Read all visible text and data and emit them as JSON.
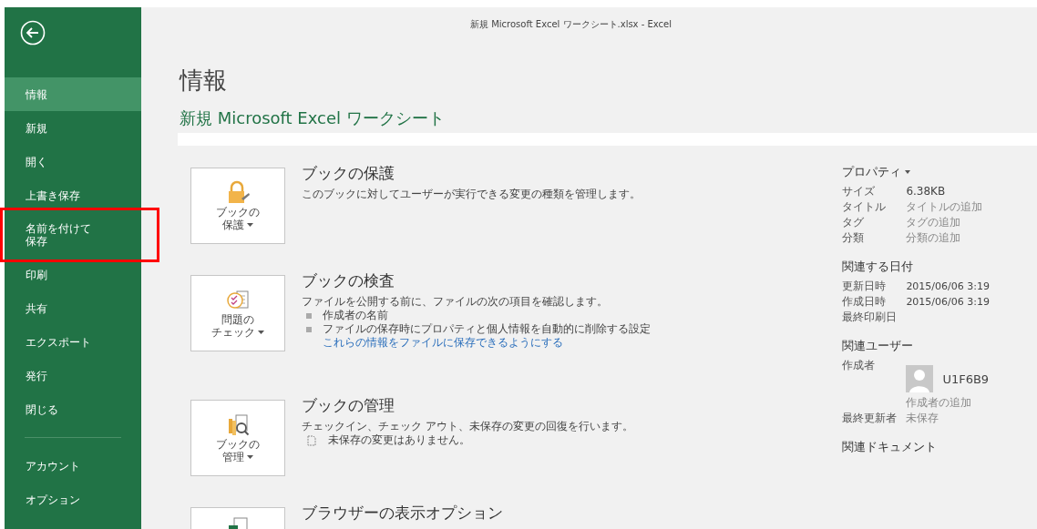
{
  "window": {
    "title": "新規 Microsoft Excel ワークシート.xlsx - Excel"
  },
  "sidebar": {
    "items": [
      {
        "label": "情報",
        "selected": true,
        "highlighted": false
      },
      {
        "label": "新規",
        "selected": false,
        "highlighted": false
      },
      {
        "label": "開く",
        "selected": false,
        "highlighted": false
      },
      {
        "label": "上書き保存",
        "selected": false,
        "highlighted": false
      },
      {
        "label": "名前を付けて保存",
        "selected": false,
        "highlighted": true
      },
      {
        "label": "印刷",
        "selected": false,
        "highlighted": false
      },
      {
        "label": "共有",
        "selected": false,
        "highlighted": false
      },
      {
        "label": "エクスポート",
        "selected": false,
        "highlighted": false
      },
      {
        "label": "発行",
        "selected": false,
        "highlighted": false
      },
      {
        "label": "閉じる",
        "selected": false,
        "highlighted": false
      }
    ],
    "bottom_items": [
      {
        "label": "アカウント",
        "selected": false,
        "highlighted": false
      },
      {
        "label": "オプション",
        "selected": false,
        "highlighted": false
      }
    ]
  },
  "page": {
    "heading": "情報",
    "document_name": "新規 Microsoft Excel ワークシート"
  },
  "sections": [
    {
      "kind": "protect",
      "button": [
        "ブックの",
        "保護"
      ],
      "title": "ブックの保護",
      "lines": [
        {
          "kind": "text",
          "text": "このブックに対してユーザーが実行できる変更の種類を管理します。"
        }
      ]
    },
    {
      "kind": "inspect",
      "button": [
        "問題の",
        "チェック"
      ],
      "title": "ブックの検査",
      "lines": [
        {
          "kind": "text",
          "text": "ファイルを公開する前に、ファイルの次の項目を確認します。"
        },
        {
          "kind": "bullet",
          "text": "作成者の名前"
        },
        {
          "kind": "bullet",
          "text": "ファイルの保存時にプロパティと個人情報を自動的に削除する設定"
        },
        {
          "kind": "link",
          "text": "これらの情報をファイルに保存できるようにする"
        }
      ]
    },
    {
      "kind": "manage",
      "button": [
        "ブックの",
        "管理"
      ],
      "title": "ブックの管理",
      "lines": [
        {
          "kind": "text",
          "text": "チェックイン、チェック アウト、未保存の変更の回復を行います。"
        },
        {
          "kind": "note",
          "text": "未保存の変更はありません。"
        }
      ]
    },
    {
      "kind": "browser",
      "title": "ブラウザーの表示オプション"
    }
  ],
  "properties": {
    "title": "プロパティ",
    "rows": [
      {
        "label": "サイズ",
        "value": "6.38KB",
        "kind": "value"
      },
      {
        "label": "タイトル",
        "value": "タイトルの追加",
        "kind": "hint"
      },
      {
        "label": "タグ",
        "value": "タグの追加",
        "kind": "hint"
      },
      {
        "label": "分類",
        "value": "分類の追加",
        "kind": "hint"
      }
    ]
  },
  "dates": {
    "title": "関連する日付",
    "rows": [
      {
        "label": "更新日時",
        "value": "2015/06/06 3:19"
      },
      {
        "label": "作成日時",
        "value": "2015/06/06 3:19"
      },
      {
        "label": "最終印刷日"
      }
    ]
  },
  "people": {
    "title": "関連ユーザー",
    "author_label": "作成者",
    "author_name": "U1F6B9",
    "add_author": "作成者の追加",
    "modified_label": "最終更新者",
    "modified_value": "未保存"
  },
  "documents": {
    "title": "関連ドキュメント"
  }
}
